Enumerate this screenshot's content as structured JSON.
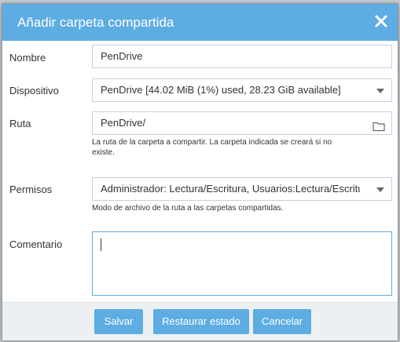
{
  "dialog": {
    "title": "Añadir carpeta compartida",
    "close_icon": "close-icon"
  },
  "form": {
    "nombre": {
      "label": "Nombre",
      "value": "PenDrive"
    },
    "dispositivo": {
      "label": "Dispositivo",
      "value": "PenDrive [44.02 MiB (1%) used, 28.23 GiB available]"
    },
    "ruta": {
      "label": "Ruta",
      "value": "PenDrive/",
      "hint_line1": "La ruta de la carpeta a compartir. La carpeta indicada se creará si no",
      "hint_line2": "existe.",
      "icon": "folder-icon"
    },
    "permisos": {
      "label": "Permisos",
      "value": "Administrador: Lectura/Escritura, Usuarios:Lectura/Escritura",
      "hint": "Modo de archivo de la ruta a las carpetas compartidas."
    },
    "comentario": {
      "label": "Comentario",
      "value": ""
    }
  },
  "footer": {
    "save_label": "Salvar",
    "reset_label": "Restaurar estado",
    "cancel_label": "Cancelar"
  },
  "colors": {
    "accent": "#5dade2",
    "footer_bg": "#edf0f2"
  }
}
